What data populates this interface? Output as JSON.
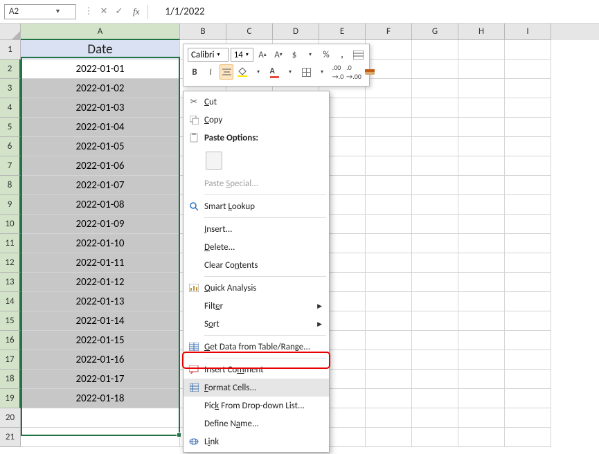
{
  "formula_bar": {
    "namebox": "A2",
    "fx_label": "fx",
    "formula_value": "1/1/2022"
  },
  "columns": [
    "A",
    "B",
    "C",
    "D",
    "E",
    "F",
    "G",
    "H",
    "I"
  ],
  "row_headers": [
    1,
    2,
    3,
    4,
    5,
    6,
    7,
    8,
    9,
    10,
    11,
    12,
    13,
    14,
    15,
    16,
    17,
    18,
    19,
    20,
    21
  ],
  "header_cell": "Date",
  "colA_values": [
    "2022-01-01",
    "2022-01-02",
    "2022-01-03",
    "2022-01-04",
    "2022-01-05",
    "2022-01-06",
    "2022-01-07",
    "2022-01-08",
    "2022-01-09",
    "2022-01-10",
    "2022-01-11",
    "2022-01-12",
    "2022-01-13",
    "2022-01-14",
    "2022-01-15",
    "2022-01-16",
    "2022-01-17",
    "2022-01-18"
  ],
  "mini_toolbar": {
    "font_name": "Calibri",
    "font_size": "14",
    "currency": "$",
    "percent": "%",
    "comma": ",",
    "bold": "B",
    "italic": "I"
  },
  "context_menu": {
    "cut": "Cut",
    "copy": "Copy",
    "paste_options": "Paste Options:",
    "paste_special": "Paste Special...",
    "smart_lookup": "Smart Lookup",
    "insert": "Insert...",
    "delete": "Delete...",
    "clear_contents": "Clear Contents",
    "quick_analysis": "Quick Analysis",
    "filter": "Filter",
    "sort": "Sort",
    "get_data": "Get Data from Table/Range...",
    "insert_comment": "Insert Comment",
    "format_cells": "Format Cells...",
    "pick_list": "Pick From Drop-down List...",
    "define_name": "Define Name...",
    "link": "Link"
  }
}
